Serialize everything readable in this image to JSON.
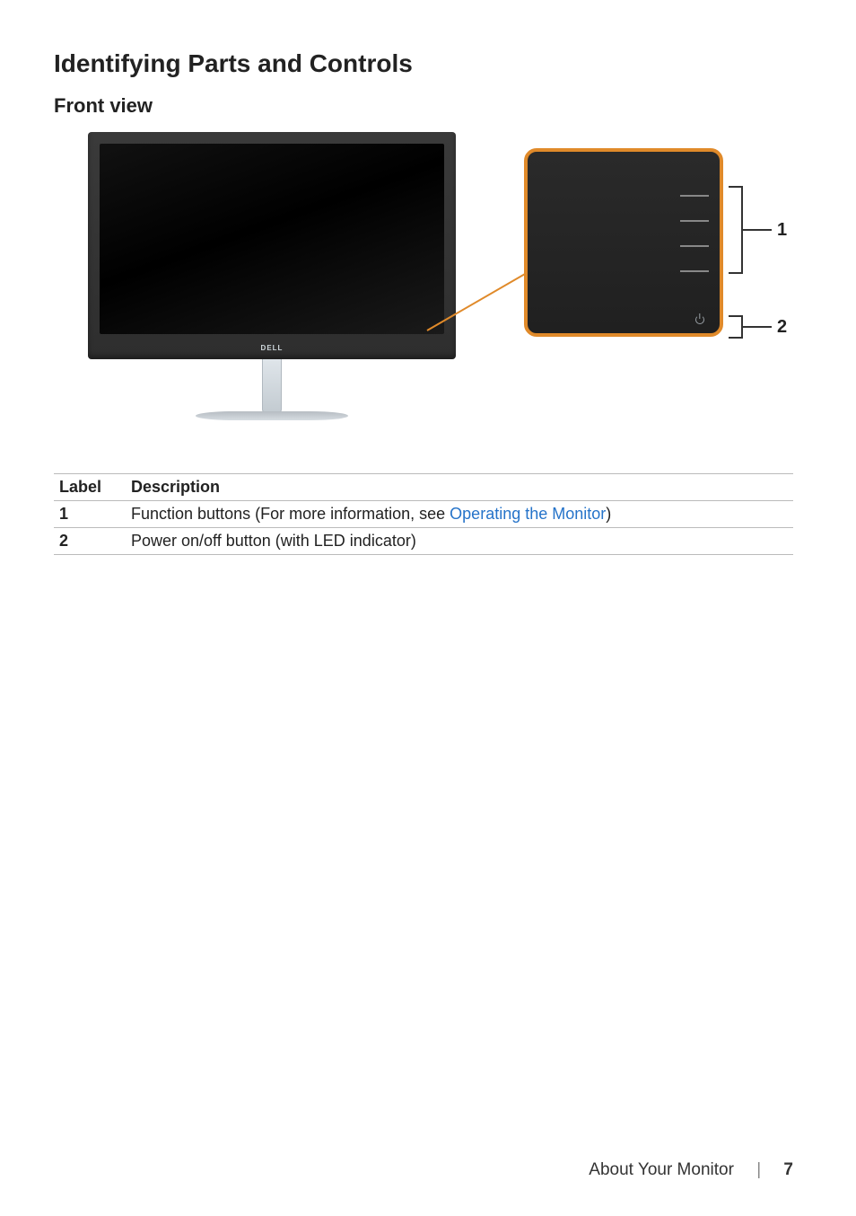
{
  "headings": {
    "section": "Identifying Parts and Controls",
    "subsection": "Front view"
  },
  "figure": {
    "brand": "DELL",
    "callouts": {
      "one": "1",
      "two": "2"
    }
  },
  "table": {
    "headers": {
      "label": "Label",
      "description": "Description"
    },
    "rows": [
      {
        "label": "1",
        "desc_prefix": "Function buttons (For more information, see ",
        "link_text": "Operating the Monitor",
        "desc_suffix": ")"
      },
      {
        "label": "2",
        "desc_full": "Power on/off button (with LED indicator)"
      }
    ]
  },
  "footer": {
    "chapter": "About Your Monitor",
    "page": "7"
  }
}
